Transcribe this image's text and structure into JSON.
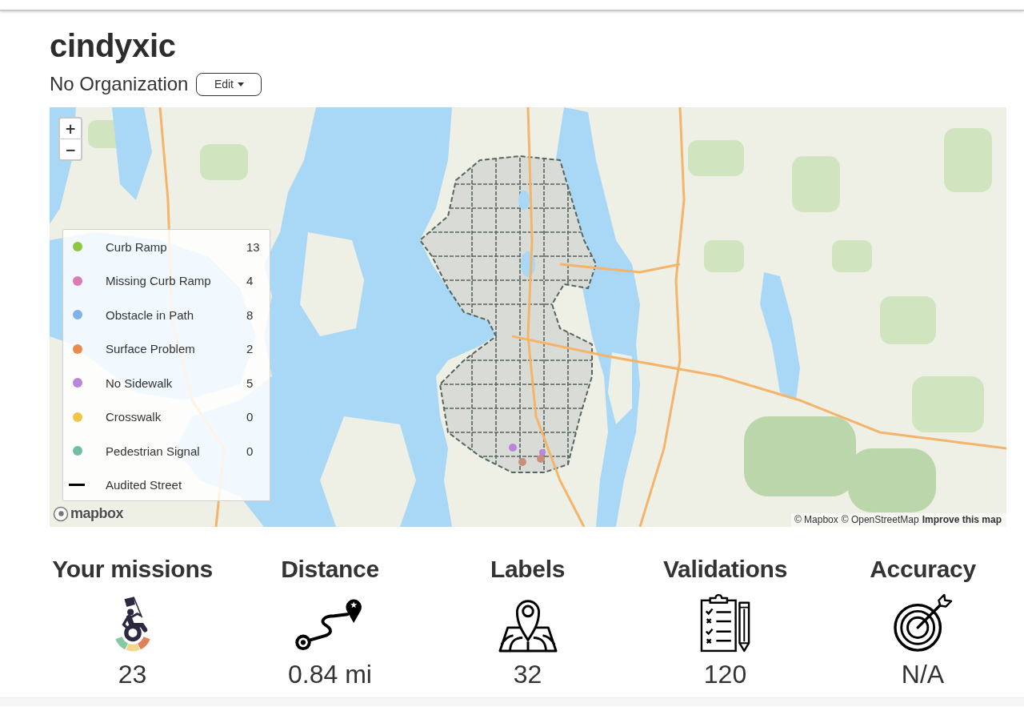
{
  "profile": {
    "username": "cindyxic",
    "organization": "No Organization",
    "edit_button": "Edit"
  },
  "map": {
    "zoom_buttons": [
      {
        "kind": "zoom_in",
        "label": "+"
      },
      {
        "kind": "zoom_out",
        "label": "−"
      }
    ],
    "legend": [
      {
        "kind": "dot",
        "label": "Curb Ramp",
        "count": "13",
        "color": "#8dc63f"
      },
      {
        "kind": "dot",
        "label": "Missing Curb Ramp",
        "count": "4",
        "color": "#dc7ab5"
      },
      {
        "kind": "dot",
        "label": "Obstacle in Path",
        "count": "8",
        "color": "#7fb2e8"
      },
      {
        "kind": "dot",
        "label": "Surface Problem",
        "count": "2",
        "color": "#e98b4a"
      },
      {
        "kind": "dot",
        "label": "No Sidewalk",
        "count": "5",
        "color": "#b987d8"
      },
      {
        "kind": "dot",
        "label": "Crosswalk",
        "count": "0",
        "color": "#f4c244"
      },
      {
        "kind": "dot",
        "label": "Pedestrian Signal",
        "count": "0",
        "color": "#6fbfa7"
      },
      {
        "kind": "line",
        "label": "Audited Street"
      }
    ],
    "logo": {
      "text": "mapbox"
    },
    "attribution": [
      {
        "kind": "link",
        "text": "© Mapbox"
      },
      {
        "kind": "link",
        "text": "© OpenStreetMap"
      },
      {
        "kind": "strong_link",
        "text": "Improve this map"
      }
    ]
  },
  "stats": [
    {
      "kind": "missions",
      "title": "Your missions",
      "value": "23"
    },
    {
      "kind": "distance",
      "title": "Distance",
      "value": "0.84 mi"
    },
    {
      "kind": "labels",
      "title": "Labels",
      "value": "32"
    },
    {
      "kind": "validations",
      "title": "Validations",
      "value": "120"
    },
    {
      "kind": "accuracy",
      "title": "Accuracy",
      "value": "N/A"
    }
  ]
}
